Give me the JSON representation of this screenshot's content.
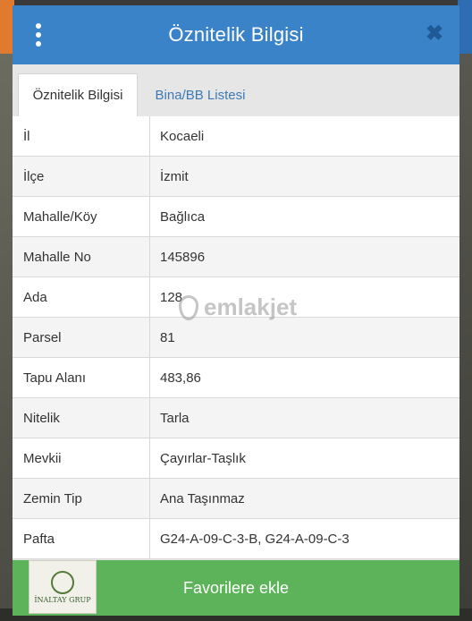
{
  "header": {
    "title": "Öznitelik Bilgisi"
  },
  "tabs": [
    {
      "label": "Öznitelik Bilgisi"
    },
    {
      "label": "Bina/BB Listesi"
    }
  ],
  "rows": [
    {
      "key": "İl",
      "value": "Kocaeli"
    },
    {
      "key": "İlçe",
      "value": "İzmit"
    },
    {
      "key": "Mahalle/Köy",
      "value": "Bağlıca"
    },
    {
      "key": "Mahalle No",
      "value": "145896"
    },
    {
      "key": "Ada",
      "value": "128"
    },
    {
      "key": "Parsel",
      "value": "81"
    },
    {
      "key": "Tapu Alanı",
      "value": "483,86"
    },
    {
      "key": "Nitelik",
      "value": "Tarla"
    },
    {
      "key": "Mevkii",
      "value": "Çayırlar-Taşlık"
    },
    {
      "key": "Zemin Tip",
      "value": "Ana Taşınmaz"
    },
    {
      "key": "Pafta",
      "value": "G24-A-09-C-3-B, G24-A-09-C-3"
    }
  ],
  "footer": {
    "button_label": "Favorilere ekle"
  },
  "watermark": {
    "text": "emlakjet"
  },
  "logo": {
    "text": "İNALTAY GRUP"
  },
  "icons": {
    "menu": "more-vertical-icon",
    "close": "close-icon"
  },
  "colors": {
    "header": "#3b83c9",
    "footer": "#5db35a",
    "tab_link": "#3d7ab5"
  }
}
